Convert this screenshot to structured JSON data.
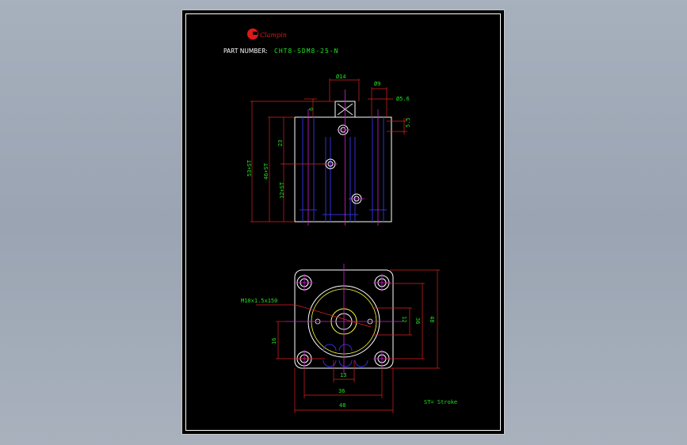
{
  "drawing": {
    "brand_name": "Clampin",
    "part_number_label": "PART NUMBER:",
    "part_number_value": "CHT8-SDM8-25-N",
    "legend": "ST= Stroke",
    "colors": {
      "background": "#000000",
      "outline": "#ffffff",
      "hidden_lines": "#2f2fd8",
      "center_lines": "#d020d0",
      "dimension_lines": "#e02020",
      "dimension_text": "#22e022"
    }
  },
  "side_view": {
    "dims": {
      "top_width": "Ø14",
      "right_width": "Ø9",
      "hole_dia": "Ø5.6",
      "small_offset": "6",
      "right_offset": "5.5",
      "height_23": "23",
      "overall_height": "53+ST",
      "mid_height": "46+ST",
      "lower_height": "12+ST"
    }
  },
  "bottom_view": {
    "dims": {
      "thread": "M10x1.5x150",
      "height_12": "12",
      "height_36": "36",
      "height_48": "48",
      "height_16": "16",
      "width_13": "13",
      "width_36": "36",
      "width_48": "48"
    }
  }
}
